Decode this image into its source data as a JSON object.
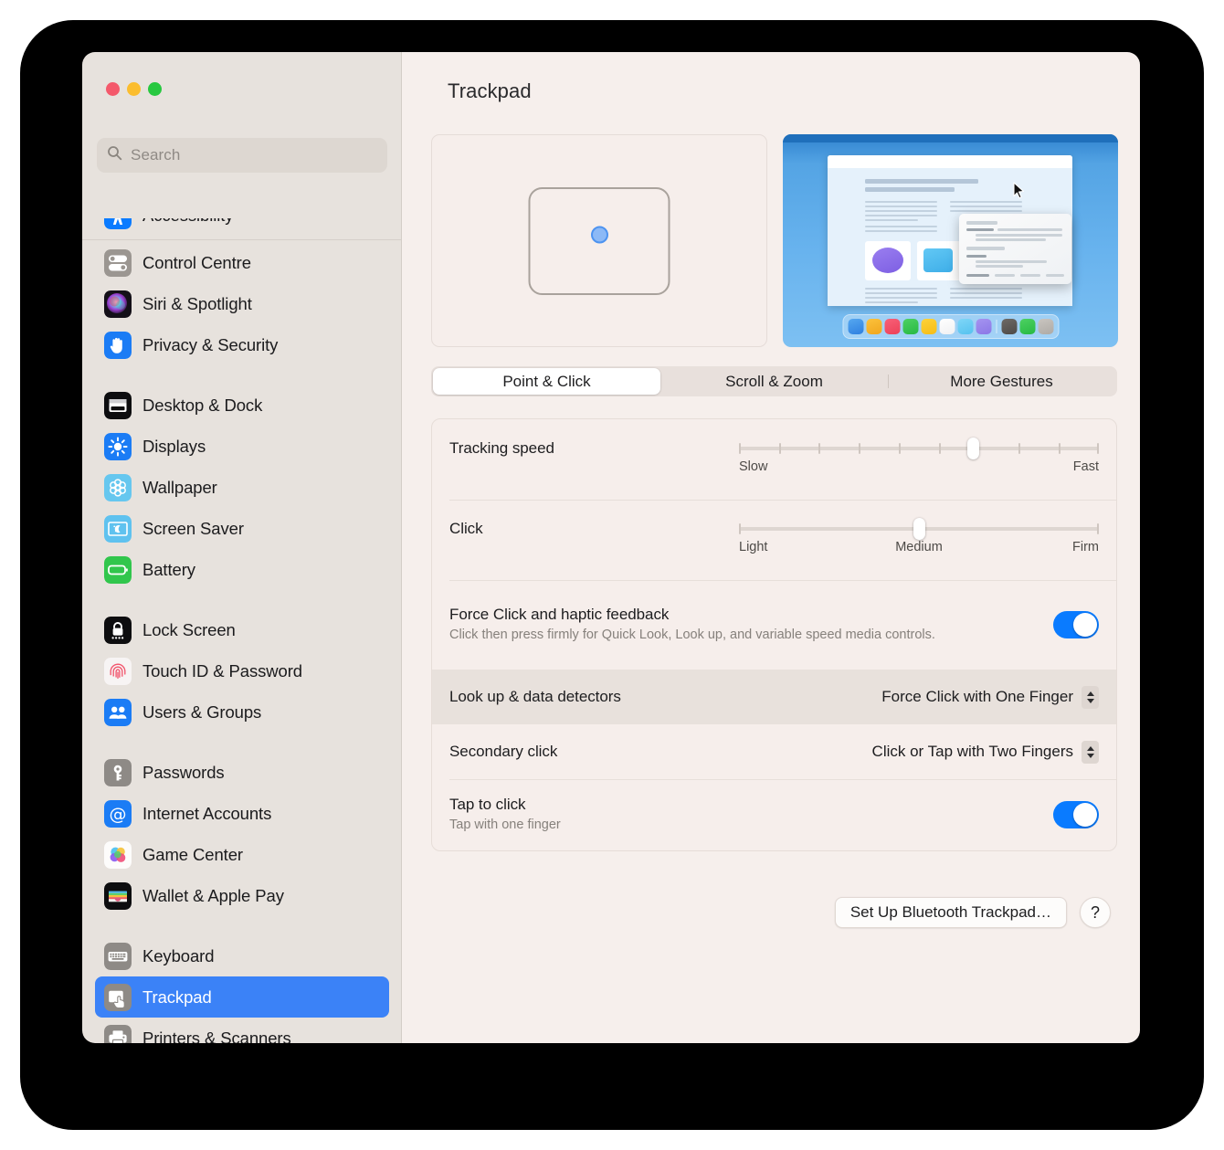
{
  "window": {
    "traffic_lights": [
      "close",
      "minimize",
      "zoom"
    ],
    "colors": {
      "close": "#f4596b",
      "minimize": "#fbbd2e",
      "zoom": "#28c840",
      "accent": "#0a7bff",
      "selection": "#3b82f7"
    }
  },
  "sidebar": {
    "search": {
      "placeholder": "Search",
      "value": "",
      "icon": "search-icon"
    },
    "groups": [
      {
        "items": [
          {
            "label": "Control Centre",
            "icon": "control-centre-icon",
            "selected": false
          },
          {
            "label": "Siri & Spotlight",
            "icon": "siri-spotlight-icon",
            "selected": false
          },
          {
            "label": "Privacy & Security",
            "icon": "privacy-security-icon",
            "selected": false
          }
        ]
      },
      {
        "items": [
          {
            "label": "Desktop & Dock",
            "icon": "desktop-dock-icon",
            "selected": false
          },
          {
            "label": "Displays",
            "icon": "displays-icon",
            "selected": false
          },
          {
            "label": "Wallpaper",
            "icon": "wallpaper-icon",
            "selected": false
          },
          {
            "label": "Screen Saver",
            "icon": "screen-saver-icon",
            "selected": false
          },
          {
            "label": "Battery",
            "icon": "battery-icon",
            "selected": false
          }
        ]
      },
      {
        "items": [
          {
            "label": "Lock Screen",
            "icon": "lock-screen-icon",
            "selected": false
          },
          {
            "label": "Touch ID & Password",
            "icon": "touch-id-icon",
            "selected": false
          },
          {
            "label": "Users & Groups",
            "icon": "users-groups-icon",
            "selected": false
          }
        ]
      },
      {
        "items": [
          {
            "label": "Passwords",
            "icon": "passwords-icon",
            "selected": false
          },
          {
            "label": "Internet Accounts",
            "icon": "internet-accounts-icon",
            "selected": false
          },
          {
            "label": "Game Center",
            "icon": "game-center-icon",
            "selected": false
          },
          {
            "label": "Wallet & Apple Pay",
            "icon": "wallet-apple-pay-icon",
            "selected": false
          }
        ]
      },
      {
        "items": [
          {
            "label": "Keyboard",
            "icon": "keyboard-icon",
            "selected": false
          },
          {
            "label": "Trackpad",
            "icon": "trackpad-icon",
            "selected": true
          },
          {
            "label": "Printers & Scanners",
            "icon": "printers-scanners-icon",
            "selected": false
          }
        ]
      }
    ]
  },
  "main": {
    "title": "Trackpad",
    "tabs": [
      {
        "label": "Point & Click",
        "active": true
      },
      {
        "label": "Scroll & Zoom",
        "active": false
      },
      {
        "label": "More Gestures",
        "active": false
      }
    ],
    "settings": [
      {
        "name": "tracking-speed",
        "label": "Tracking speed",
        "control": "slider",
        "value_percent": 65,
        "ticks": 10,
        "scale_left": "Slow",
        "scale_mid": "",
        "scale_right": "Fast"
      },
      {
        "name": "click",
        "label": "Click",
        "control": "slider",
        "value_percent": 50,
        "ticks": 0,
        "scale_left": "Light",
        "scale_mid": "Medium",
        "scale_right": "Firm"
      },
      {
        "name": "force-click",
        "label": "Force Click and haptic feedback",
        "sublabel": "Click then press firmly for Quick Look, Look up, and variable speed media controls.",
        "control": "toggle",
        "value": "on"
      },
      {
        "name": "look-up-data-detectors",
        "label": "Look up & data detectors",
        "control": "popup",
        "value": "Force Click with One Finger",
        "highlighted": true
      },
      {
        "name": "secondary-click",
        "label": "Secondary click",
        "control": "popup",
        "value": "Click or Tap with Two Fingers",
        "highlighted": false
      },
      {
        "name": "tap-to-click",
        "label": "Tap to click",
        "sublabel": "Tap with one finger",
        "control": "toggle",
        "value": "on"
      }
    ],
    "footer": {
      "setup_button": "Set Up Bluetooth Trackpad…",
      "help_button": "?"
    },
    "preview": {
      "trackpad_illustration": "trackpad-diagram",
      "video_preview": "force-click-demo-video"
    }
  }
}
